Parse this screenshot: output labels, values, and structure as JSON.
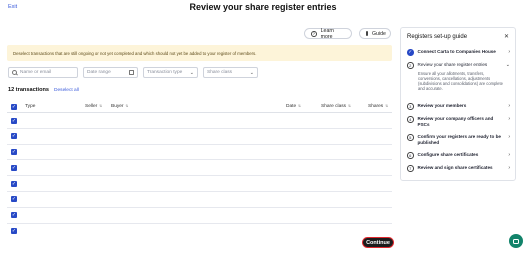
{
  "header": {
    "exit_label": "Exit",
    "title": "Review your share register entries",
    "learn_more_label": "Learn more",
    "guide_label": "Guide"
  },
  "banner": {
    "text": "Deselect transactions that are still ongoing or not yet completed and which should not yet be added to your register of members."
  },
  "filters": {
    "search_placeholder": "Name or email",
    "date_range_placeholder": "Date range",
    "transaction_type_placeholder": "Transaction type",
    "share_class_placeholder": "Share class"
  },
  "summary": {
    "count_label": "12 transactions",
    "deselect_label": "Deselect all"
  },
  "table": {
    "columns": [
      "Type",
      "Seller",
      "Buyer",
      "Date",
      "Share class",
      "Shares"
    ],
    "rows": [
      {
        "selected": true
      },
      {
        "selected": true
      },
      {
        "selected": true
      },
      {
        "selected": true
      },
      {
        "selected": true
      },
      {
        "selected": true
      },
      {
        "selected": true
      },
      {
        "selected": true
      }
    ]
  },
  "guide": {
    "title": "Registers set-up guide",
    "steps": [
      {
        "number": "",
        "label": "Connect Carta to Companies House",
        "state": "done"
      },
      {
        "number": "2",
        "label": "Review your share register entries",
        "state": "current",
        "description": "Ensure all your allotments, transfers, conversions, cancellations, adjustments (subdivisions and consolidations) are complete and accurate."
      },
      {
        "number": "3",
        "label": "Review your members",
        "state": "todo"
      },
      {
        "number": "4",
        "label": "Review your company officers and PSCs",
        "state": "todo"
      },
      {
        "number": "5",
        "label": "Confirm your registers are ready to be published",
        "state": "todo"
      },
      {
        "number": "6",
        "label": "Configure share certificates",
        "state": "todo"
      },
      {
        "number": "7",
        "label": "Review and sign share certificates",
        "state": "todo"
      }
    ]
  },
  "footer": {
    "continue_label": "Continue"
  },
  "colors": {
    "accent": "#2749c6",
    "banner_bg": "#fdf4d9",
    "chat": "#12836a",
    "continue_border": "#e0282e"
  },
  "icons": {
    "help": "question-circle-icon",
    "guide": "book-icon",
    "search": "search-icon",
    "calendar": "calendar-icon",
    "close": "close-icon",
    "chat": "chat-icon"
  }
}
